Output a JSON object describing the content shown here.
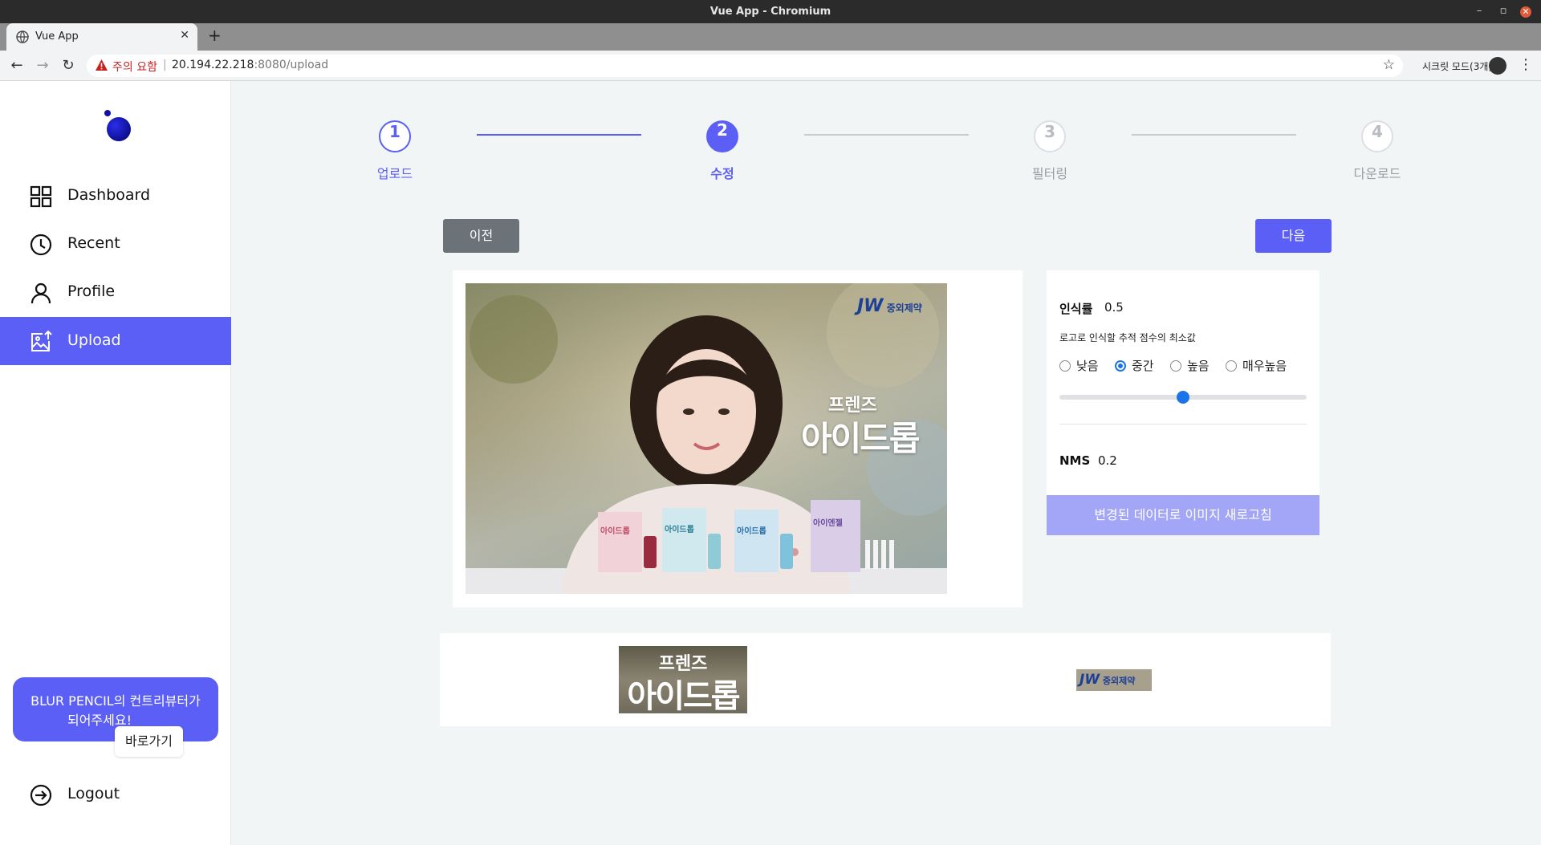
{
  "browser": {
    "window_title": "Vue App - Chromium",
    "tab_title": "Vue App",
    "security_label": "주의 요함",
    "url_host": "20.194.22.218",
    "url_rest": ":8080/upload",
    "incognito_label": "시크릿 모드(3개)"
  },
  "sidebar": {
    "items": [
      {
        "label": "Dashboard",
        "icon": "grid-icon"
      },
      {
        "label": "Recent",
        "icon": "clock-icon"
      },
      {
        "label": "Profile",
        "icon": "user-icon"
      },
      {
        "label": "Upload",
        "icon": "image-upload-icon",
        "active": true
      }
    ],
    "contrib_text_line1": "BLUR PENCIL의 컨트리뷰터가",
    "contrib_text_line2": "되어주세요!",
    "contrib_button": "바로가기",
    "logout_label": "Logout"
  },
  "stepper": {
    "steps": [
      {
        "number": "1",
        "label": "업로드",
        "state": "done"
      },
      {
        "number": "2",
        "label": "수정",
        "state": "current"
      },
      {
        "number": "3",
        "label": "필터링",
        "state": "todo"
      },
      {
        "number": "4",
        "label": "다운로드",
        "state": "todo"
      }
    ]
  },
  "actions": {
    "prev_label": "이전",
    "next_label": "다음"
  },
  "ad_image": {
    "brand_text": "중외제약",
    "brand_mark": "JW",
    "headline_small": "프렌즈",
    "headline_large": "아이드롭",
    "box_labels": [
      "아이드롭",
      "아이드롭",
      "아이드롭",
      "아이엔젤"
    ]
  },
  "settings": {
    "confidence_title": "인식률",
    "confidence_value": "0.5",
    "confidence_desc": "로고로 인식할 추적 점수의 최소값",
    "options": [
      "낮음",
      "중간",
      "높음",
      "매우높음"
    ],
    "selected_option": "중간",
    "slider_value": 0.5,
    "nms_title": "NMS",
    "nms_value": "0.2",
    "refresh_label": "변경된 데이터로 이미지 새로고침"
  },
  "detections": {
    "crop1_line1": "프렌즈",
    "crop1_line2": "아이드롭",
    "crop2_mark": "JW",
    "crop2_text": "중외제약"
  },
  "colors": {
    "accent": "#5b5ff5",
    "accent_light": "#a3a6f6",
    "prev_button": "#6b7278",
    "app_bg": "#f1f5f6",
    "radio_selected": "#1a73e8"
  }
}
